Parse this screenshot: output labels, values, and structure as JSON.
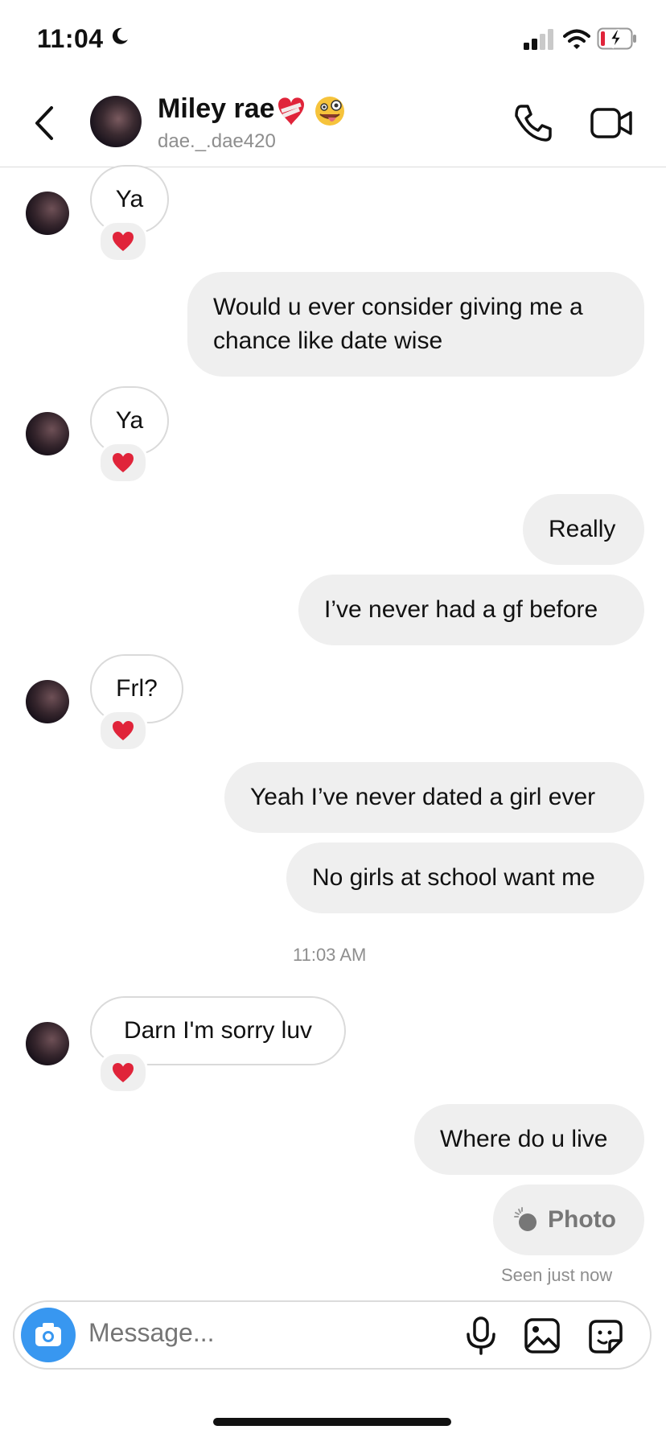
{
  "status_bar": {
    "time": "11:04",
    "icons": [
      "moon-icon",
      "signal-icon",
      "wifi-icon",
      "battery-charging-icon"
    ]
  },
  "header": {
    "name": "Miley rae",
    "username": "dae._.dae420",
    "emoji": [
      "mending-heart-emoji",
      "zany-face-emoji"
    ],
    "icons": [
      "back-chevron-icon",
      "phone-icon",
      "video-camera-icon"
    ]
  },
  "messages": [
    {
      "from": "them",
      "text": "Ya",
      "reaction": "heart"
    },
    {
      "from": "me",
      "text": "Would u ever consider giving me a chance like date wise"
    },
    {
      "from": "them",
      "text": "Ya",
      "reaction": "heart"
    },
    {
      "from": "me",
      "text": "Really"
    },
    {
      "from": "me",
      "text": "I’ve never had a gf before"
    },
    {
      "from": "them",
      "text": "Frl?",
      "reaction": "heart"
    },
    {
      "from": "me",
      "text": "Yeah I’ve never dated a girl ever"
    },
    {
      "from": "me",
      "text": "No girls at school want me"
    },
    {
      "type": "timestamp",
      "text": "11:03 AM"
    },
    {
      "from": "them",
      "text": "Darn I'm sorry luv",
      "reaction": "heart"
    },
    {
      "from": "me",
      "text": "Where do u live"
    },
    {
      "from": "me",
      "text": "Photo",
      "kind": "photo"
    }
  ],
  "seen": "Seen just now",
  "composer": {
    "placeholder": "Message...",
    "icons": [
      "camera-icon",
      "microphone-icon",
      "gallery-icon",
      "sticker-icon"
    ]
  },
  "colors": {
    "accent": "#3897f0",
    "out_bubble": "#efefef",
    "in_border": "#dadada",
    "heart": "#e0243a"
  }
}
